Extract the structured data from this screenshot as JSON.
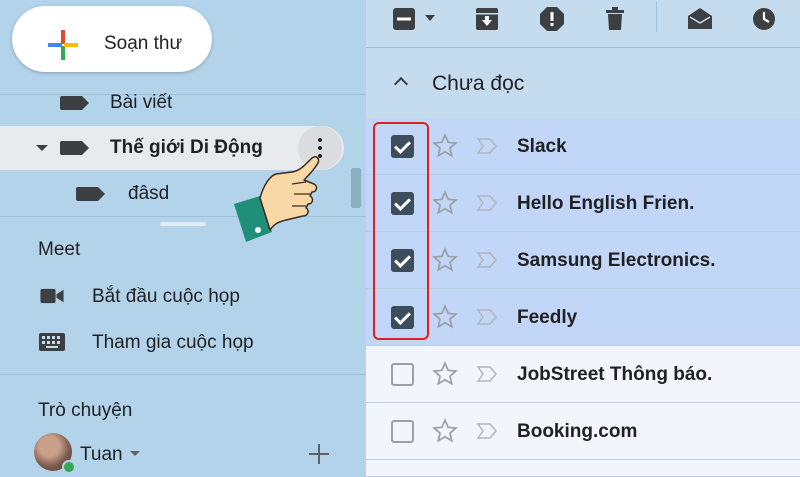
{
  "compose": {
    "label": "Soạn thư"
  },
  "labels": [
    {
      "name": "Bài viết"
    },
    {
      "name": "Thế giới Di Động"
    },
    {
      "name": "đâsd"
    }
  ],
  "meet": {
    "title": "Meet",
    "start": "Bắt đầu cuộc họp",
    "join": "Tham gia cuộc họp"
  },
  "chat": {
    "title": "Trò chuyện",
    "user": "Tuan"
  },
  "section": {
    "title": "Chưa đọc"
  },
  "emails": [
    {
      "sender": "Slack",
      "selected": true
    },
    {
      "sender": "Hello English Frien.",
      "selected": true
    },
    {
      "sender": "Samsung Electronics.",
      "selected": true
    },
    {
      "sender": "Feedly",
      "selected": true
    },
    {
      "sender": "JobStreet Thông báo.",
      "selected": false
    },
    {
      "sender": "Booking.com",
      "selected": false
    }
  ],
  "icons": {
    "toolbar": [
      "select-all-checkbox-icon",
      "dropdown-caret-icon",
      "archive-icon",
      "report-spam-icon",
      "delete-icon",
      "mark-as-read-icon",
      "snooze-icon"
    ],
    "sidebar": [
      "compose-plus-icon",
      "label-icon",
      "more-vert-icon",
      "video-camera-icon",
      "keyboard-icon",
      "add-chat-icon"
    ],
    "rows": [
      "checkbox-icon",
      "star-icon",
      "important-marker-icon"
    ]
  },
  "colors": {
    "sidebar_bg": "#b3d3ea",
    "selected_row": "#c2d7f7",
    "unselected_row": "#f2f6fc",
    "highlight": "#e02020",
    "presence": "#34a853"
  }
}
